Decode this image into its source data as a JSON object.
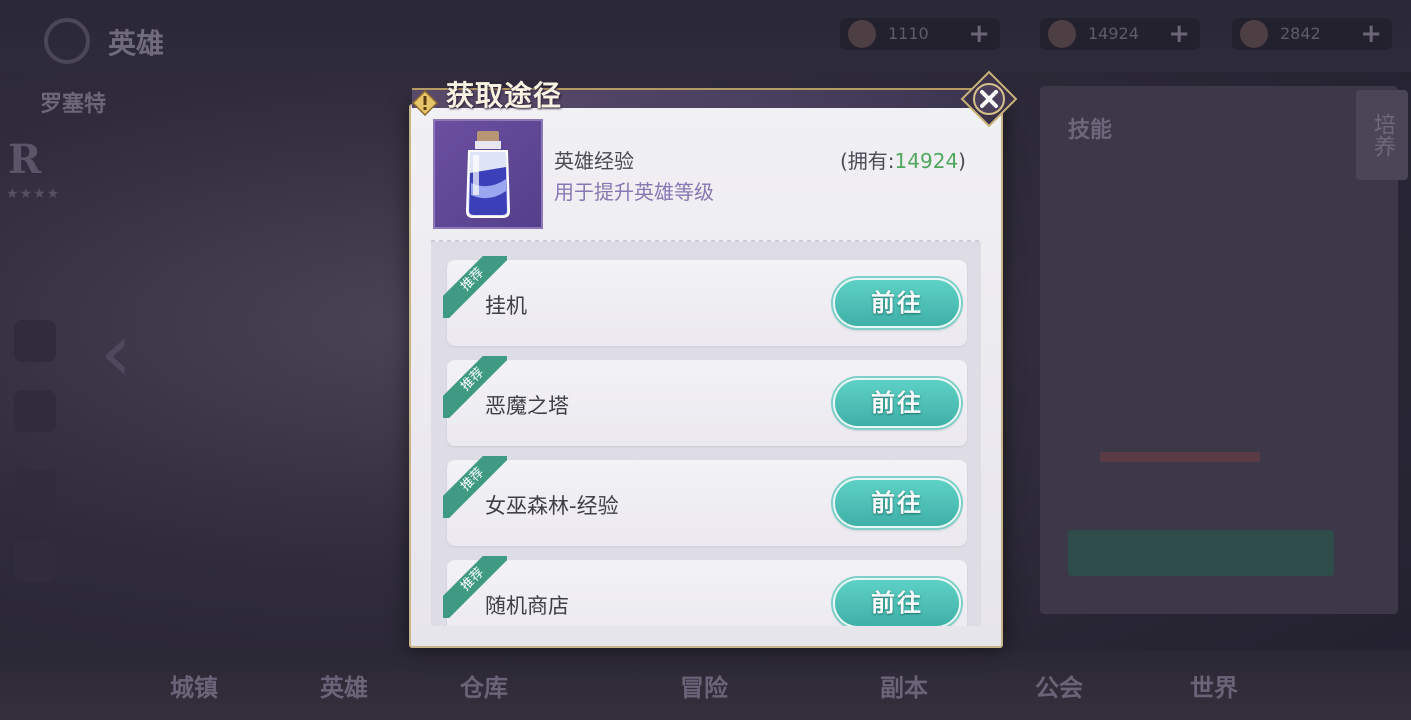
{
  "background": {
    "screen_title": "英雄",
    "hero_name": "罗塞特",
    "hero_rank": "R",
    "resources": [
      {
        "value": "1110",
        "icon": "coin-icon"
      },
      {
        "value": "14924",
        "icon": "exp-icon"
      },
      {
        "value": "2842",
        "icon": "gem-icon"
      }
    ],
    "panel_title": "技能",
    "side_tab": "培养",
    "bottom_nav": [
      "城镇",
      "英雄",
      "仓库",
      "冒险",
      "副本",
      "公会",
      "世界"
    ]
  },
  "dialog": {
    "title": "获取途径",
    "item": {
      "name": "英雄经验",
      "description": "用于提升英雄等级",
      "owned_label": "(拥有:",
      "owned_value": "14924",
      "owned_suffix": ")",
      "icon": "exp-potion-icon"
    },
    "recommend_tag": "推荐",
    "go_label": "前往",
    "sources": [
      {
        "label": "挂机",
        "recommended": true
      },
      {
        "label": "恶魔之塔",
        "recommended": true
      },
      {
        "label": "女巫森林-经验",
        "recommended": true
      },
      {
        "label": "随机商店",
        "recommended": true
      }
    ]
  },
  "colors": {
    "accent_teal": "#4fc0b6",
    "owned_green": "#4fa85d",
    "desc_purple": "#8877b5",
    "ribbon_green": "#3f9a83"
  }
}
